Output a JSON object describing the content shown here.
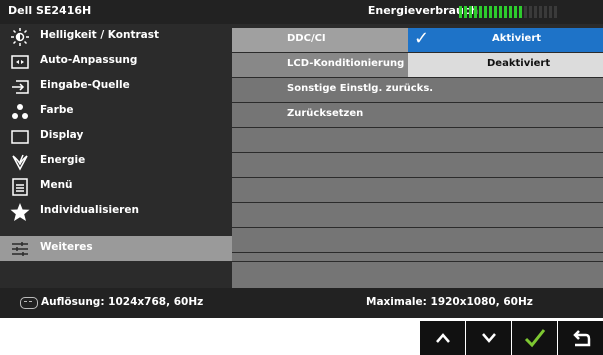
{
  "title_bar": {
    "model": "Dell SE2416H",
    "energy_label": "Energieverbrauch",
    "energy_meter": {
      "total_segments": 20,
      "active_segments": 13,
      "active_color": "#2dcc2d",
      "inactive_color": "#3a3a3a"
    }
  },
  "menu": {
    "items": [
      {
        "label": "Helligkeit / Kontrast",
        "icon": "brightness-icon"
      },
      {
        "label": "Auto-Anpassung",
        "icon": "auto-adjust-icon"
      },
      {
        "label": "Eingabe-Quelle",
        "icon": "input-source-icon"
      },
      {
        "label": "Farbe",
        "icon": "color-icon"
      },
      {
        "label": "Display",
        "icon": "display-icon"
      },
      {
        "label": "Energie",
        "icon": "energy-icon"
      },
      {
        "label": "Menü",
        "icon": "menu-icon"
      },
      {
        "label": "Individualisieren",
        "icon": "personalize-icon"
      },
      {
        "label": "Weiteres",
        "icon": "others-icon"
      }
    ],
    "selected_label": "Weiteres"
  },
  "settings": {
    "ddc_label": "DDC/CI",
    "ddc_value": "Aktiviert",
    "lcd_label": "LCD-Konditionierung",
    "lcd_value": "Deaktiviert",
    "reset_other": "Sonstige Einstlg. zurücks.",
    "reset_all": "Zurücksetzen"
  },
  "status_bar": {
    "resolution": "Auflösung: 1024x768, 60Hz",
    "maximum": "Maximale: 1920x1080, 60Hz"
  },
  "buttons": {
    "up": "∧",
    "down": "∨",
    "ok": "✓",
    "back": "⮌"
  },
  "colors": {
    "selected_value_bg": "#1e73c8",
    "check_green": "#7ec832"
  }
}
